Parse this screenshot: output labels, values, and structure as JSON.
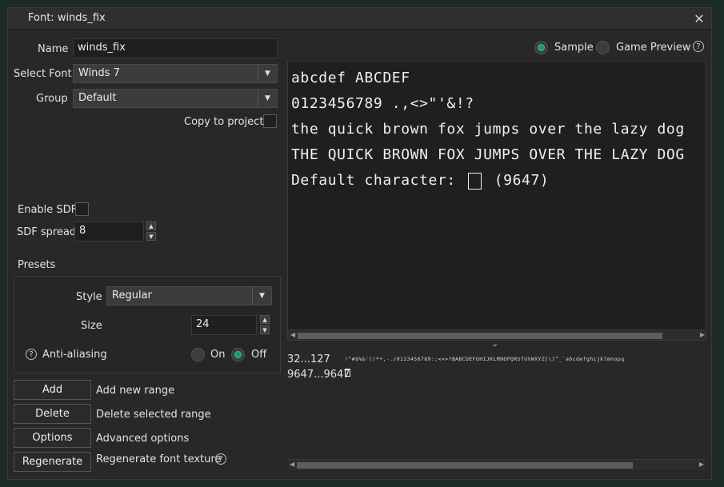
{
  "window": {
    "title": "Font: winds_fix",
    "close_glyph": "✕"
  },
  "form": {
    "name_label": "Name",
    "name_value": "winds_fix",
    "select_font_label": "Select Font",
    "select_font_value": "Winds 7",
    "group_label": "Group",
    "group_value": "Default",
    "copy_to_project_label": "Copy to project",
    "enable_sdf_label": "Enable SDF",
    "sdf_spread_label": "SDF spread",
    "sdf_spread_value": "8"
  },
  "presets": {
    "title": "Presets",
    "style_label": "Style",
    "style_value": "Regular",
    "size_label": "Size",
    "size_value": "24",
    "anti_aliasing_label": "Anti-aliasing",
    "on_label": "On",
    "off_label": "Off",
    "selected": "Off"
  },
  "range_actions": [
    {
      "button": "Add",
      "description": "Add new range"
    },
    {
      "button": "Delete",
      "description": "Delete selected range"
    },
    {
      "button": "Options",
      "description": "Advanced options"
    },
    {
      "button": "Regenerate",
      "description": "Regenerate font texture"
    }
  ],
  "preview_mode": {
    "sample_label": "Sample",
    "game_preview_label": "Game Preview",
    "selected": "Sample"
  },
  "sample_lines": [
    "abcdef ABCDEF",
    "0123456789 .,<>\"'&!?",
    "the quick brown fox jumps over the lazy dog",
    "THE QUICK BROWN FOX JUMPS OVER THE LAZY DOG"
  ],
  "default_character": {
    "prefix": "Default character:",
    "code": "(9647)"
  },
  "ranges": [
    {
      "range": "32...127",
      "glyphs": "!\"#$%&'()*+,-./0123456789:;<=>?@ABCDEFGHIJKLMNOPQRSTUVWXYZ[\\]^_`abcdefghijklmnopq"
    },
    {
      "range": "9647...9647",
      "glyphs": ""
    }
  ],
  "colors": {
    "accent_green": "#1e9b5e",
    "panel_bg": "#282828",
    "preview_bg": "#1f1f1f"
  },
  "icons": [
    "close-icon",
    "help-icon",
    "chevron-down-icon",
    "collapse-chevron-icon"
  ]
}
